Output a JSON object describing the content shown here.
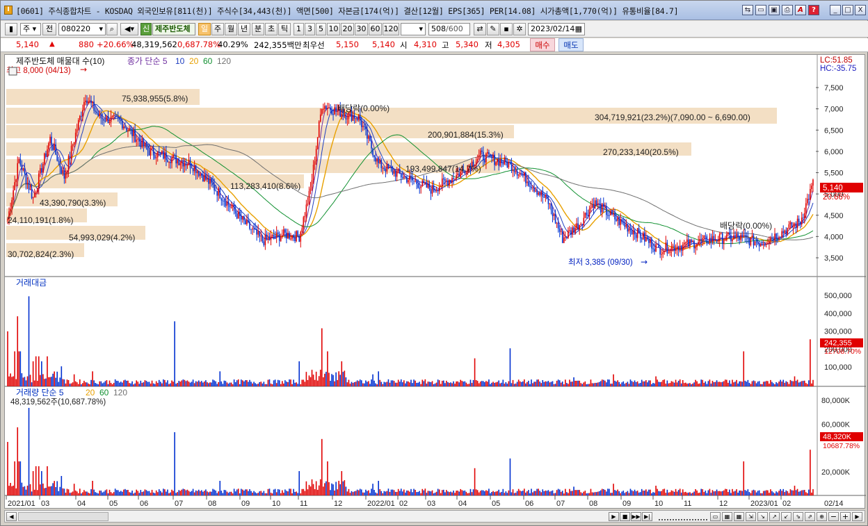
{
  "window": {
    "title": "[0601] 주식종합차트 - KOSDAQ 외국인보유[811(천)] 주식수[34,443(천)] 액면[500] 자본금[174(억)] 결산[12월] EPS[365] PER[14.08] 시가총액[1,770(억)] 유통비율[84.7]",
    "btn_min": "_",
    "btn_restore": "□",
    "btn_close": "X"
  },
  "toolbar": {
    "type_sel": "주",
    "type_mode": "전",
    "code": "080220",
    "new_badge": "신",
    "stock_name": "제주반도체",
    "period_day": "일",
    "period_week": "주",
    "period_month": "월",
    "period_year": "년",
    "period_min": "분",
    "period_sec": "초",
    "period_tick": "틱",
    "intervals": [
      "1",
      "3",
      "5",
      "10",
      "20",
      "30",
      "60",
      "120"
    ],
    "count": "508",
    "count_max": "/600",
    "date": "2023/02/14"
  },
  "quote": {
    "price": "5,140",
    "change": "880",
    "change_pct": "+20.66%",
    "volume": "48,319,562",
    "turnover": "0,687.78%",
    "ratio": "40.29%",
    "amount": "242,355백만",
    "best_label": "최우선",
    "ask": "5,150",
    "bid": "5,140",
    "open_label": "시",
    "open": "4,310",
    "high_label": "고",
    "high": "5,340",
    "low_label": "저",
    "low": "4,305",
    "buy": "매수",
    "sell": "매도"
  },
  "price_pane": {
    "legend_name": "제주반도체 매물대 수(10)",
    "ma_label": "종가 단순 5",
    "ma_periods": [
      "10",
      "20",
      "60",
      "120"
    ],
    "lc": "LC:51.85",
    "hc": "HC:-35.75",
    "high_note": "최고 8,000 (04/13)",
    "low_note": "최저 3,385 (09/30)",
    "div1": "배당락(0.00%)",
    "div2": "배당락(0.00%)",
    "price_tag": "5,140",
    "pct_tag": "20.66%",
    "y_ticks": [
      "7,500",
      "7,000",
      "6,500",
      "6,000",
      "5,500",
      "5,000",
      "4,500",
      "4,000",
      "3,500"
    ],
    "profile_labels": [
      "75,938,955(5.8%)",
      "304,719,921(23.2%)(7,090.00 ~ 6,690.00)",
      "200,901,884(15.3%)",
      "270,233,140(20.5%)",
      "193,499,847(14.7%)",
      "113,283,410(8.6%)",
      "43,390,790(3.3%)",
      "24,110,191(1.8%)",
      "54,993,029(4.2%)",
      "30,702,824(2.3%)"
    ]
  },
  "amount_pane": {
    "legend": "거래대금",
    "y_ticks": [
      "500,000",
      "400,000",
      "300,000",
      "200,000",
      "100,000"
    ],
    "tag": "242,355",
    "tag2": "12708.70%"
  },
  "volume_pane": {
    "legend": "거래량 단순 5",
    "periods": [
      "20",
      "60",
      "120"
    ],
    "value_line": "48,319,562주(10,687.78%)",
    "y_ticks": [
      "80,000K",
      "60,000K",
      "20,000K"
    ],
    "tag": "48,320K",
    "tag2": "10687.78%"
  },
  "x_axis": [
    "2021/01",
    "03",
    "04",
    "05",
    "06",
    "07",
    "08",
    "09",
    "10",
    "11",
    "12",
    "2022/01",
    "02",
    "03",
    "04",
    "05",
    "06",
    "07",
    "08",
    "09",
    "10",
    "11",
    "12",
    "2023/01",
    "02"
  ],
  "x_last": "02/14",
  "colors": {
    "up": "#e00000",
    "down": "#0030d0",
    "ma5": "#7030a0",
    "ma10": "#2040c0",
    "ma20": "#e8a000",
    "ma60": "#109030",
    "ma120": "#707070",
    "profile": "#f3dfc4"
  }
}
